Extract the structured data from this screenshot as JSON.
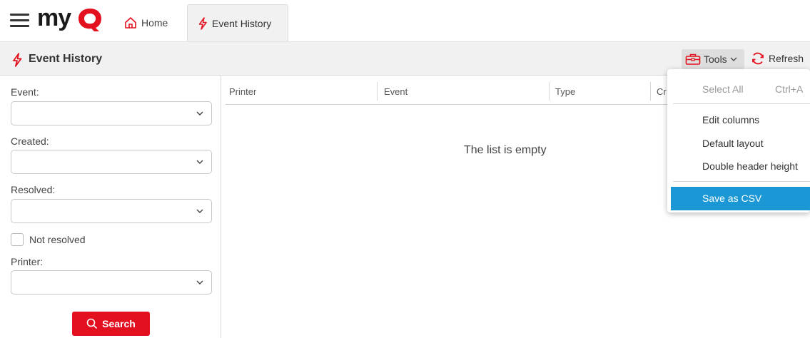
{
  "brand": {
    "logo_text": "myQ",
    "accent_color": "#e3101f"
  },
  "tabs": [
    {
      "label": "Home",
      "icon": "home-icon"
    },
    {
      "label": "Event History",
      "icon": "bolt-icon",
      "active": true
    }
  ],
  "page": {
    "title": "Event History",
    "toolbar": {
      "tools_label": "Tools",
      "refresh_label": "Refresh"
    }
  },
  "filters": {
    "event_label": "Event:",
    "event_value": "",
    "created_label": "Created:",
    "created_value": "",
    "resolved_label": "Resolved:",
    "resolved_value": "",
    "not_resolved_label": "Not resolved",
    "not_resolved_checked": false,
    "printer_label": "Printer:",
    "printer_value": "",
    "search_label": "Search"
  },
  "grid": {
    "columns": [
      "Printer",
      "Event",
      "Type",
      "Cr"
    ],
    "empty_text": "The list is empty"
  },
  "tools_menu": {
    "items": [
      {
        "label": "Select All",
        "shortcut": "Ctrl+A",
        "disabled": true
      },
      {
        "label": "Edit columns"
      },
      {
        "label": "Default layout"
      },
      {
        "label": "Double header height"
      },
      {
        "label": "Save as CSV",
        "highlighted": true
      }
    ],
    "highlight_color": "#1a97d4"
  }
}
